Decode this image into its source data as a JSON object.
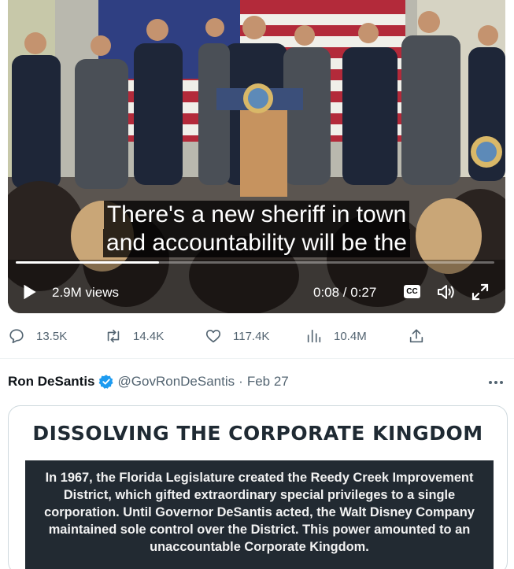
{
  "video": {
    "caption_line1": "There's a new sheriff in town",
    "caption_line2": "and accountability will be the",
    "views": "2.9M views",
    "time": "0:08 / 0:27",
    "cc_label": "CC",
    "progress_fraction": 0.3,
    "icons": [
      "play-icon",
      "closed-captions-icon",
      "volume-icon",
      "fullscreen-icon"
    ]
  },
  "actions": {
    "replies": "13.5K",
    "reposts": "14.4K",
    "likes": "117.4K",
    "views": "10.4M",
    "icons": [
      "reply-icon",
      "repost-icon",
      "like-icon",
      "analytics-icon",
      "share-icon"
    ]
  },
  "tweet": {
    "author": "Ron DeSantis",
    "handle": "@GovRonDeSantis",
    "separator": "·",
    "date": "Feb 27",
    "media": {
      "title": "DISSOLVING THE CORPORATE KINGDOM",
      "body": "In 1967, the Florida Legislature created the Reedy Creek Improvement District, which gifted extraordinary special privileges to a single corporation. Until Governor DeSantis acted, the Walt Disney Company maintained sole control over the District. This power amounted to an unaccountable Corporate Kingdom."
    }
  },
  "colors": {
    "text": "#0f1419",
    "secondary": "#536471",
    "verified": "#1d9bf0",
    "infographic_bg": "#222a32"
  }
}
